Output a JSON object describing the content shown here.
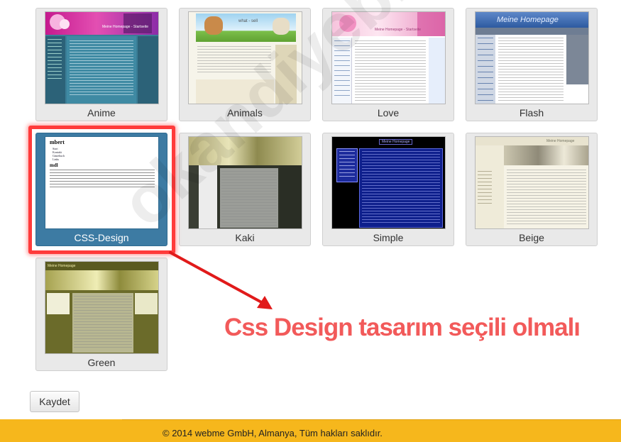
{
  "themes": [
    {
      "label": "Anime",
      "selected": false
    },
    {
      "label": "Animals",
      "selected": false
    },
    {
      "label": "Love",
      "selected": false
    },
    {
      "label": "Flash",
      "selected": false
    },
    {
      "label": "CSS-Design",
      "selected": true
    },
    {
      "label": "Kaki",
      "selected": false
    },
    {
      "label": "Simple",
      "selected": false
    },
    {
      "label": "Beige",
      "selected": false
    },
    {
      "label": "Green",
      "selected": false
    }
  ],
  "thumb_text": {
    "anime_title": "Meine Homepage - Startseite",
    "animals_title": "what - sell",
    "love_title": "Meine Homepage - Startseite",
    "flash_title": "Meine Homepage",
    "css_heading": "mbert",
    "css_subheading": "mdl",
    "css_list": [
      "Start",
      "Kontakt",
      "Gästebuch",
      "Links"
    ],
    "simple_title": "Meine Homepage",
    "beige_title": "Meine Homepage",
    "green_title": "Meine Homepage"
  },
  "annotation": "Css Design tasarım seçili olmalı",
  "watermark": "okandiyebiri.com",
  "save_button": "Kaydet",
  "footer": "© 2014 webme GmbH, Almanya, Tüm hakları saklıdır.",
  "colors": {
    "selected_tile": "#3d7ba3",
    "highlight": "#ff3b3b",
    "annotation": "#f25a5a",
    "footer_bg": "#f6b71c"
  }
}
